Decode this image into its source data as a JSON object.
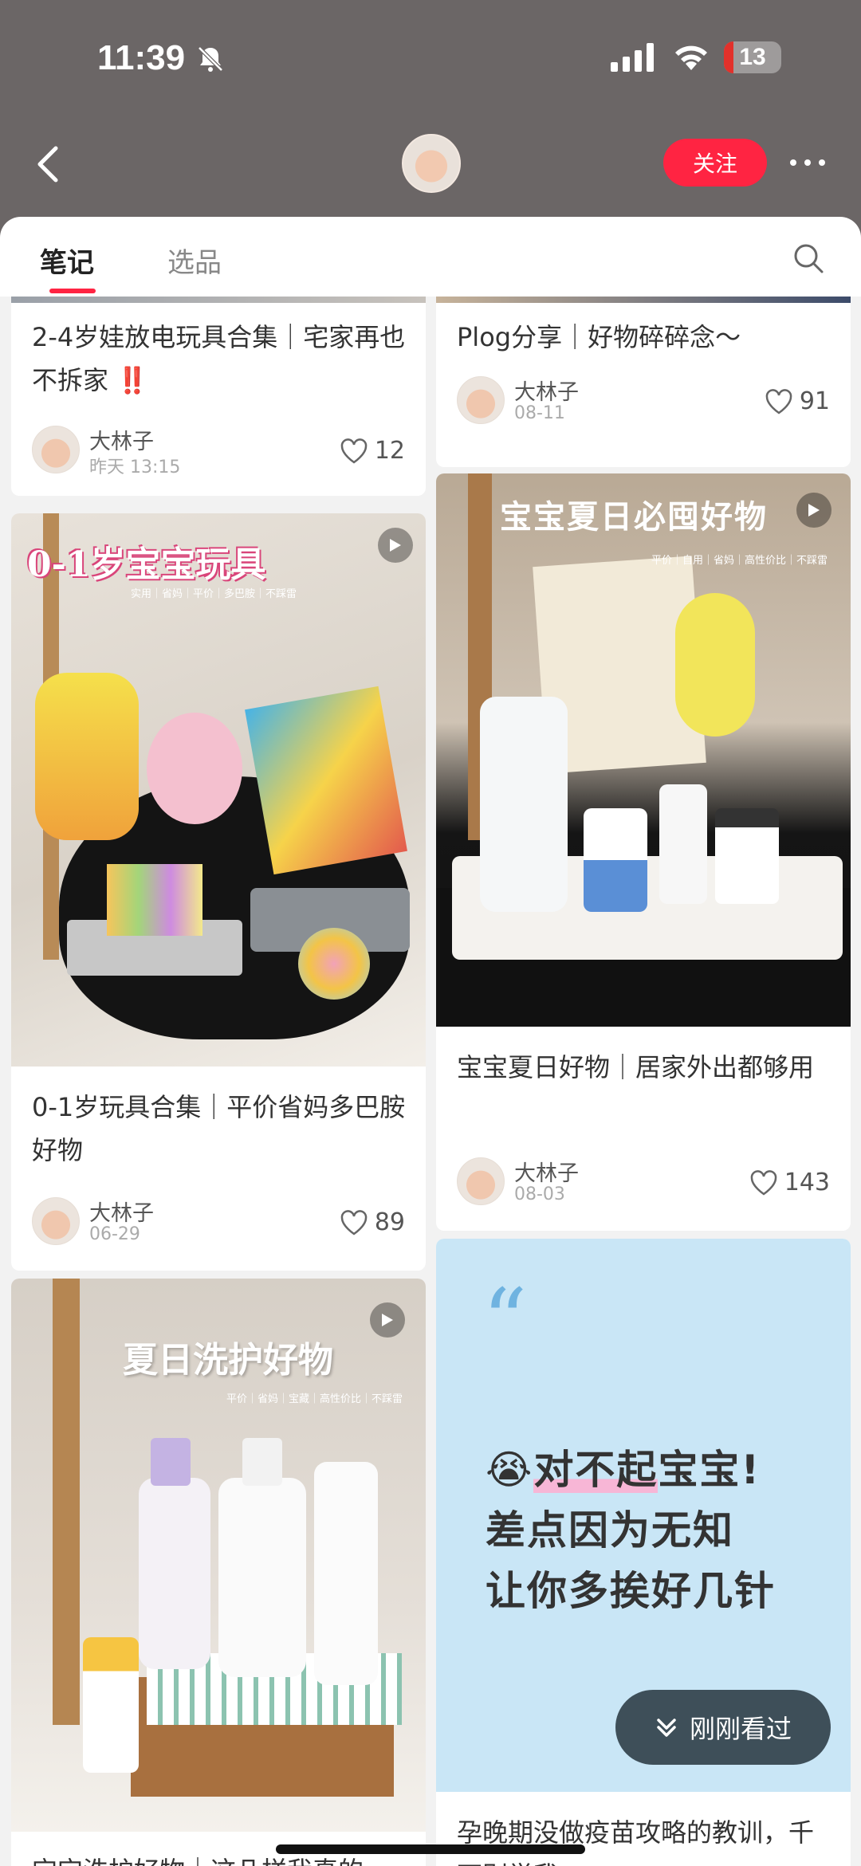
{
  "status_bar": {
    "time": "11:39",
    "battery": "13"
  },
  "header": {
    "follow_label": "关注"
  },
  "tabs": {
    "notes": "笔记",
    "picks": "选品"
  },
  "cards": {
    "c1": {
      "title": "2-4岁娃放电玩具合集｜宅家再也不拆家 ‼️",
      "author": "大林子",
      "date": "昨天 13:15",
      "likes": "12"
    },
    "c2": {
      "title": "Plog分享｜好物碎碎念～",
      "author": "大林子",
      "date": "08-11",
      "likes": "91"
    },
    "c3": {
      "cover_title": "0-1岁宝宝玩具",
      "cover_sub": "实用｜省妈｜平价｜多巴胺｜不踩雷",
      "title": "0-1岁玩具合集｜平价省妈多巴胺好物",
      "author": "大林子",
      "date": "06-29",
      "likes": "89"
    },
    "c4": {
      "cover_title": "宝宝夏日必囤好物",
      "cover_sub": "平价｜自用｜省妈｜高性价比｜不踩雷",
      "title": "宝宝夏日好物｜居家外出都够用",
      "author": "大林子",
      "date": "08-03",
      "likes": "143"
    },
    "c5": {
      "cover_title": "夏日洗护好物",
      "cover_sub": "平价｜省妈｜宝藏｜高性价比｜不踩雷",
      "title": "宝宝洗护好物｜这几样我真的"
    },
    "c6": {
      "quote_line1_emoji": "😭",
      "quote_line1_hl": "对不起",
      "quote_line1_rest": "宝宝!",
      "quote_line2": "差点因为无知",
      "quote_line3": "让你多挨好几针",
      "title": "孕晚期没做疫苗攻略的教训，千万别学我"
    }
  },
  "recent_pill": {
    "label": "刚刚看过"
  },
  "icons": [
    "bell-off-icon",
    "signal-icon",
    "wifi-icon",
    "back-icon",
    "more-icon",
    "search-icon",
    "heart-icon",
    "play-icon",
    "chevron-double-down-icon"
  ],
  "colors": {
    "accent": "#ff2442",
    "header_bg": "#6b6666",
    "quote_bg": "#c9e6f6"
  }
}
